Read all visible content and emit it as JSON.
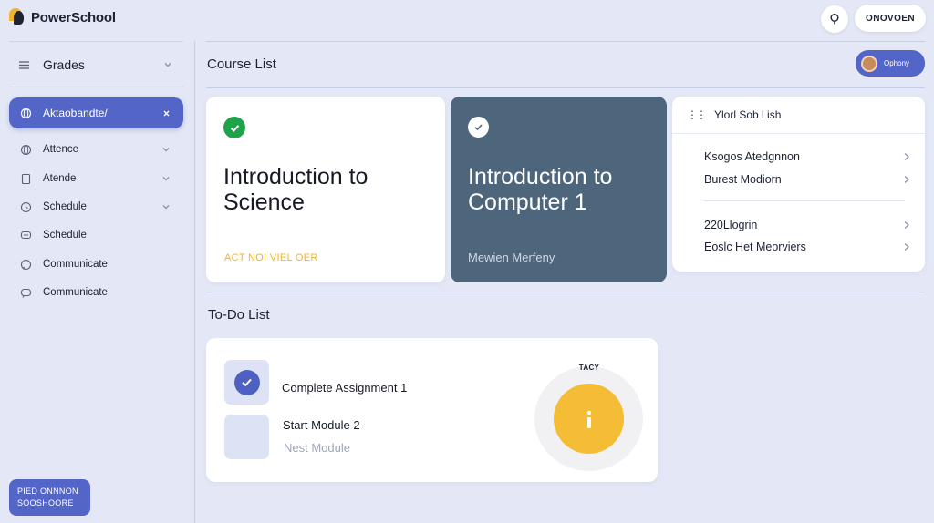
{
  "app": {
    "name": "PowerSchool"
  },
  "topbar": {
    "button_label": "ONOVOEN",
    "icon": "lightbulb-icon"
  },
  "sidebar": {
    "grades_label": "Grades",
    "active_item": {
      "label": "Aktaobandte/",
      "icon": "globe-icon",
      "close_icon": "close-icon"
    },
    "items": [
      {
        "label": "Attence",
        "icon": "globe-icon",
        "chevron": true
      },
      {
        "label": "Atende",
        "icon": "square-icon",
        "chevron": true
      },
      {
        "label": "Schedule",
        "icon": "clock-icon",
        "chevron": true
      },
      {
        "label": "Schedule",
        "icon": "chat-icon",
        "chevron": false
      },
      {
        "label": "Communicate",
        "icon": "chat-icon",
        "chevron": false
      },
      {
        "label": "Communicate",
        "icon": "chat-icon",
        "chevron": false
      }
    ],
    "bottom_button": {
      "line1": "PIED ONNNON",
      "line2": "SOOSHOORE"
    }
  },
  "main": {
    "course_list_title": "Course List",
    "profile_chip_label": "Ophony",
    "cards": [
      {
        "title_line1": "Introduction to",
        "title_line2": "Science",
        "footer": "ACT NOI VIEL OER"
      },
      {
        "title_line1": "Introduction to",
        "title_line2": "Computer 1",
        "footer": "Mewien Merfeny"
      }
    ],
    "side_list": {
      "title": "Ylorl Sob l ish",
      "rows": [
        "Ksogos Atedgnnon",
        "Burest Modiorn",
        "220Llogrin",
        "Eoslc Het Meorviers"
      ]
    },
    "todo_title": "To-Do List",
    "todo": {
      "items": [
        {
          "label": "Complete Assignment 1",
          "checked": true
        },
        {
          "label": "Start Module 2",
          "sublabel": "Nest Module",
          "checked": false
        }
      ],
      "gauge_label": "TACY",
      "gauge_icon": "info-icon"
    }
  },
  "colors": {
    "background": "#e4e8f6",
    "accent": "#5465c8",
    "dark_card": "#4e667c",
    "success": "#1fa34a",
    "warning": "#f5bd35",
    "gold_text": "#f0b429"
  }
}
